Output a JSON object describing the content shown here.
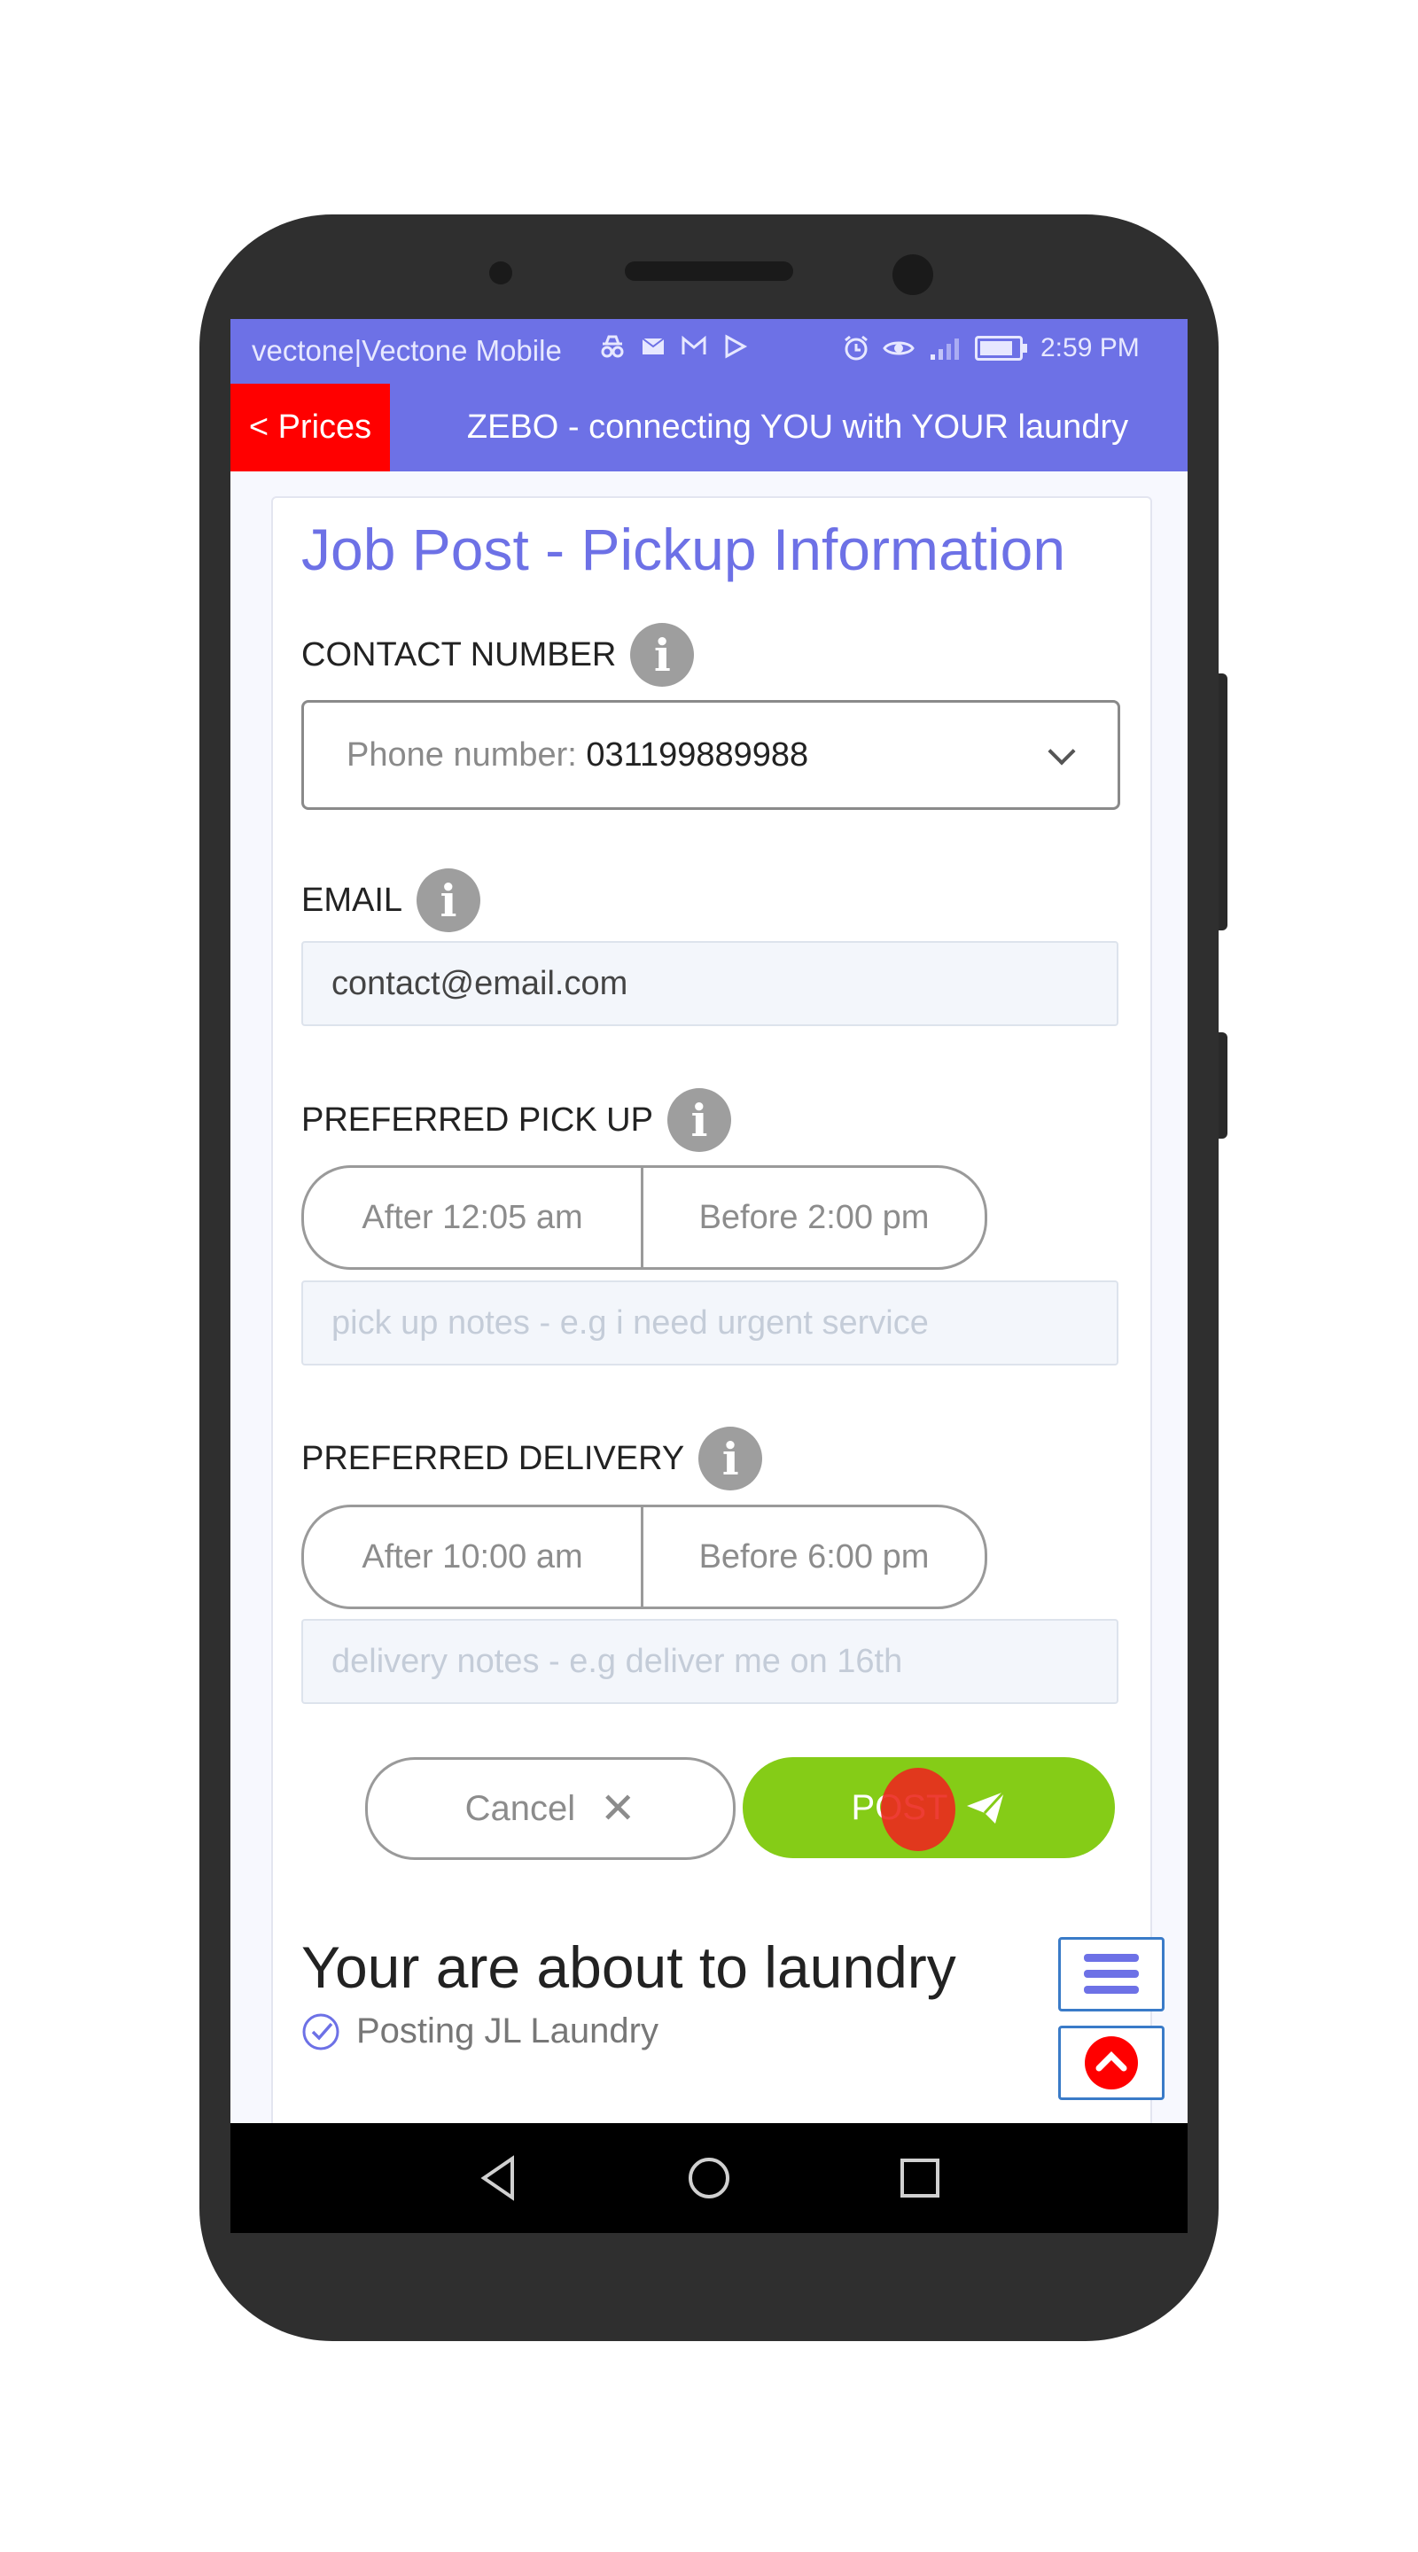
{
  "statusbar": {
    "carrier": "vectone|Vectone Mobile",
    "time": "2:59 PM",
    "left_icons": [
      "incognito-icon",
      "message-icon",
      "gmail-icon",
      "play-store-icon"
    ],
    "right_icons": [
      "alarm-icon",
      "eye-icon",
      "signal-icon",
      "battery-icon"
    ]
  },
  "appbar": {
    "back_label": "< Prices",
    "title": "ZEBO - connecting YOU with YOUR laundry"
  },
  "form": {
    "title": "Job Post - Pickup Information",
    "contact": {
      "label": "CONTACT NUMBER",
      "prefix": "Phone number: ",
      "value": "031199889988"
    },
    "email": {
      "label": "EMAIL",
      "value": "contact@email.com"
    },
    "pickup": {
      "label": "PREFERRED PICK UP",
      "after": "After 12:05 am",
      "before": "Before 2:00 pm",
      "notes_placeholder": "pick up notes - e.g i need urgent service"
    },
    "delivery": {
      "label": "PREFERRED DELIVERY",
      "after": "After 10:00 am",
      "before": "Before 6:00 pm",
      "notes_placeholder": "delivery notes - e.g deliver me on 16th"
    },
    "cancel_label": "Cancel",
    "post_label": "POST"
  },
  "summary": {
    "title": "Your are about to laundry",
    "items": [
      "Posting JL Laundry"
    ]
  },
  "colors": {
    "accent": "#6d71e6",
    "danger": "#ff0000",
    "post": "#85cc17",
    "fab_border": "#3a7bc8"
  }
}
